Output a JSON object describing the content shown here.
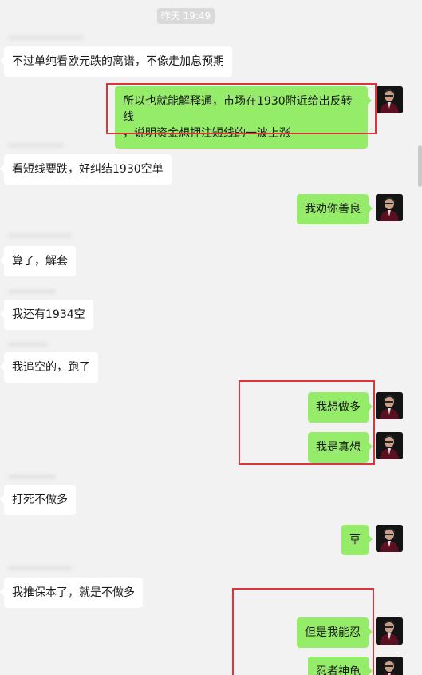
{
  "timestamp": "昨天 19:49",
  "messages": [
    {
      "side": "left",
      "text": "不过单纯看欧元跌的离谱，不像走加息预期"
    },
    {
      "side": "right",
      "line1": "所以也就能解释通，市场在1930附近给出反转线",
      "line2": "，说明资金想押注短线的一波上涨"
    },
    {
      "side": "left",
      "text": "看短线要跌，好纠结1930空单"
    },
    {
      "side": "right",
      "text": "我劝你善良"
    },
    {
      "side": "left",
      "text": "算了，解套"
    },
    {
      "side": "left",
      "text": "我还有1934空"
    },
    {
      "side": "left",
      "text": "我追空的，跑了"
    },
    {
      "side": "right",
      "text": "我想做多"
    },
    {
      "side": "right",
      "text": "我是真想"
    },
    {
      "side": "left",
      "text": "打死不做多"
    },
    {
      "side": "right",
      "text": "草"
    },
    {
      "side": "left",
      "text": "我推保本了，就是不做多"
    },
    {
      "side": "right",
      "text": "但是我能忍"
    },
    {
      "side": "right",
      "text": "忍者神龟"
    }
  ],
  "colors": {
    "right_bubble": "#95ec69",
    "left_bubble": "#ffffff",
    "background": "#f2f2f2",
    "highlight_box": "#e0343b"
  },
  "icons": {
    "avatar": "user-avatar-icon"
  }
}
